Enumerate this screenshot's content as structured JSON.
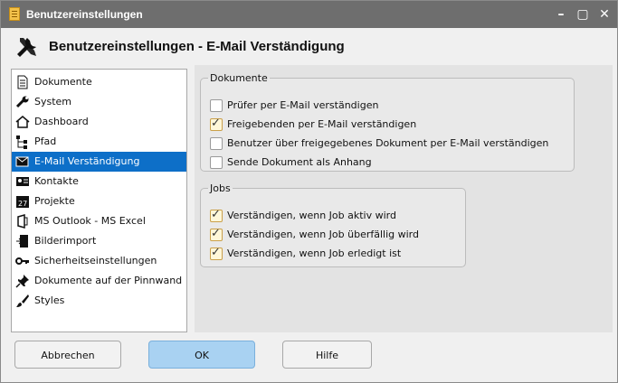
{
  "window": {
    "title": "Benutzereinstellungen"
  },
  "header": {
    "title": "Benutzereinstellungen - E-Mail Verständigung"
  },
  "sidebar": {
    "selected_index": 4,
    "items": [
      {
        "label": "Dokumente",
        "icon": "document-icon"
      },
      {
        "label": "System",
        "icon": "wrench-icon"
      },
      {
        "label": "Dashboard",
        "icon": "home-icon"
      },
      {
        "label": "Pfad",
        "icon": "tree-icon"
      },
      {
        "label": "E-Mail Verständigung",
        "icon": "mail-icon"
      },
      {
        "label": "Kontakte",
        "icon": "contact-card-icon"
      },
      {
        "label": "Projekte",
        "icon": "calendar-icon"
      },
      {
        "label": "MS Outlook - MS Excel",
        "icon": "office-icon"
      },
      {
        "label": "Bilderimport",
        "icon": "import-icon"
      },
      {
        "label": "Sicherheitseinstellungen",
        "icon": "key-icon"
      },
      {
        "label": "Dokumente auf der Pinnwand",
        "icon": "pin-icon"
      },
      {
        "label": "Styles",
        "icon": "brush-icon"
      }
    ]
  },
  "groups": {
    "dokumente": {
      "title": "Dokumente",
      "options": [
        {
          "label": "Prüfer per E-Mail verständigen",
          "checked": false
        },
        {
          "label": "Freigebenden per E-Mail verständigen",
          "checked": true
        },
        {
          "label": "Benutzer über freigegebenes Dokument per E-Mail verständigen",
          "checked": false
        },
        {
          "label": "Sende Dokument als Anhang",
          "checked": false
        }
      ]
    },
    "jobs": {
      "title": "Jobs",
      "options": [
        {
          "label": "Verständigen, wenn Job aktiv wird",
          "checked": true
        },
        {
          "label": "Verständigen, wenn Job überfällig wird",
          "checked": true
        },
        {
          "label": "Verständigen, wenn Job erledigt ist",
          "checked": true
        }
      ]
    }
  },
  "footer": {
    "cancel_label": "Abbrechen",
    "ok_label": "OK",
    "help_label": "Hilfe"
  },
  "colors": {
    "titlebar": "#6e6e6e",
    "selection": "#0d6fc8",
    "primary_button": "#a9d2f2"
  }
}
